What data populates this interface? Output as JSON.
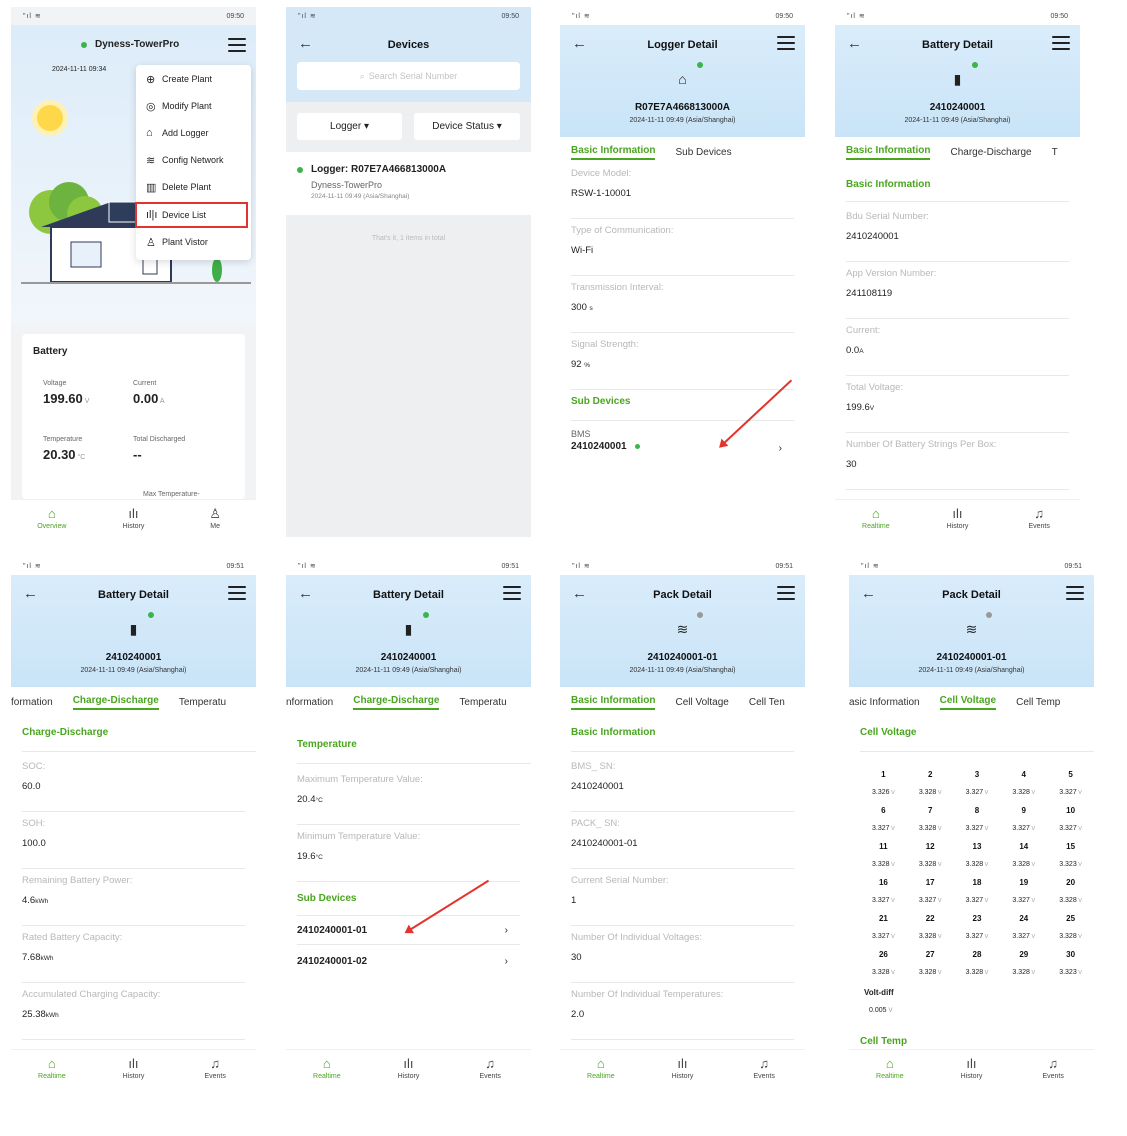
{
  "status": {
    "time1": "09:50",
    "time2": "09:51",
    "signal": "\"ıl ≋"
  },
  "p1": {
    "plant": "Dyness-TowerPro",
    "date": "2024-11-11 09:34",
    "menu": [
      "Create Plant",
      "Modify Plant",
      "Add Logger",
      "Config Network",
      "Delete Plant",
      "Device List",
      "Plant Vistor"
    ],
    "battery_title": "Battery",
    "voltage_label": "Voltage",
    "voltage": "199.60",
    "voltage_unit": "V",
    "current_label": "Current",
    "current": "0.00",
    "current_unit": "A",
    "temp_label": "Temperature",
    "temp": "20.30",
    "temp_unit": "°C",
    "discharged_label": "Total Discharged",
    "discharged": "--",
    "maxtemp_label": "Max Temperature-",
    "nav": [
      "Overview",
      "History",
      "Me"
    ]
  },
  "p2": {
    "title": "Devices",
    "search_placeholder": "Search Serial Number",
    "filter1": "Logger ▾",
    "filter2": "Device Status ▾",
    "logger": "Logger: R07E7A466813000A",
    "plant": "Dyness-TowerPro",
    "ts": "2024-11-11 09:49 (Asia/Shanghai)",
    "footer": "That's it, 1 items in total"
  },
  "p3": {
    "title": "Logger Detail",
    "sn": "R07E7A466813000A",
    "ts": "2024-11-11 09:49 (Asia/Shanghai)",
    "tabs": [
      "Basic Information",
      "Sub Devices"
    ],
    "fields": [
      {
        "label": "Device Model:",
        "value": "RSW-1-10001",
        "unit": ""
      },
      {
        "label": "Type of Communication:",
        "value": "Wi-Fi",
        "unit": ""
      },
      {
        "label": "Transmission Interval:",
        "value": "300",
        "unit": "s"
      },
      {
        "label": "Signal Strength:",
        "value": "92",
        "unit": "%"
      }
    ],
    "sub_title": "Sub Devices",
    "sub_type": "BMS",
    "sub_sn": "2410240001"
  },
  "p4": {
    "title": "Battery Detail",
    "sn": "2410240001",
    "ts": "2024-11-11 09:49 (Asia/Shanghai)",
    "tabs": [
      "Basic Information",
      "Charge-Discharge",
      "T"
    ],
    "sec": "Basic Information",
    "fields": [
      {
        "label": "Bdu Serial Number:",
        "value": "2410240001",
        "unit": ""
      },
      {
        "label": "App Version Number:",
        "value": "241108119",
        "unit": ""
      },
      {
        "label": "Current:",
        "value": "0.0",
        "unit": "A"
      },
      {
        "label": "Total Voltage:",
        "value": "199.6",
        "unit": "V"
      },
      {
        "label": "Number Of Battery Strings Per Box:",
        "value": "30",
        "unit": ""
      }
    ]
  },
  "nav2": [
    "Realtime",
    "History",
    "Events"
  ],
  "p5": {
    "title": "Battery Detail",
    "sn": "2410240001",
    "ts": "2024-11-11 09:49 (Asia/Shanghai)",
    "tabs": [
      "formation",
      "Charge-Discharge",
      "Temperatu"
    ],
    "sec": "Charge-Discharge",
    "fields": [
      {
        "label": "SOC:",
        "value": "60.0",
        "unit": ""
      },
      {
        "label": "SOH:",
        "value": "100.0",
        "unit": ""
      },
      {
        "label": "Remaining Battery Power:",
        "value": "4.6",
        "unit": "kWh"
      },
      {
        "label": "Rated Battery Capacity:",
        "value": "7.68",
        "unit": "kWh"
      },
      {
        "label": "Accumulated Charging Capacity:",
        "value": "25.38",
        "unit": "kWh"
      }
    ]
  },
  "p6": {
    "title": "Battery Detail",
    "sn": "2410240001",
    "ts": "2024-11-11 09:49 (Asia/Shanghai)",
    "tabs": [
      "nformation",
      "Charge-Discharge",
      "Temperatu"
    ],
    "sec": "Temperature",
    "fields": [
      {
        "label": "Maximum Temperature Value:",
        "value": "20.4",
        "unit": "°C"
      },
      {
        "label": "Minimum Temperature Value:",
        "value": "19.6",
        "unit": "°C"
      }
    ],
    "sub_title": "Sub Devices",
    "subs": [
      "2410240001-01",
      "2410240001-02"
    ]
  },
  "p7": {
    "title": "Pack Detail",
    "sn": "2410240001-01",
    "ts": "2024-11-11 09:49 (Asia/Shanghai)",
    "tabs": [
      "Basic Information",
      "Cell Voltage",
      "Cell Ten"
    ],
    "sec": "Basic Information",
    "fields": [
      {
        "label": "BMS_ SN:",
        "value": "2410240001",
        "unit": ""
      },
      {
        "label": "PACK_ SN:",
        "value": "2410240001-01",
        "unit": ""
      },
      {
        "label": "Current Serial Number:",
        "value": "1",
        "unit": ""
      },
      {
        "label": "Number Of Individual Voltages:",
        "value": "30",
        "unit": ""
      },
      {
        "label": "Number Of Individual Temperatures:",
        "value": "2.0",
        "unit": ""
      }
    ]
  },
  "p8": {
    "title": "Pack Detail",
    "sn": "2410240001-01",
    "ts": "2024-11-11 09:49 (Asia/Shanghai)",
    "tabs": [
      "asic Information",
      "Cell Voltage",
      "Cell Temp"
    ],
    "sec": "Cell Voltage",
    "cells": [
      "3.326",
      "3.328",
      "3.327",
      "3.328",
      "3.327",
      "3.327",
      "3.328",
      "3.327",
      "3.327",
      "3.327",
      "3.328",
      "3.328",
      "3.328",
      "3.328",
      "3.323",
      "3.327",
      "3.327",
      "3.327",
      "3.327",
      "3.328",
      "3.327",
      "3.328",
      "3.327",
      "3.327",
      "3.328",
      "3.328",
      "3.328",
      "3.328",
      "3.328",
      "3.323"
    ],
    "cell_unit": "V",
    "volt_diff_label": "Volt-diff",
    "volt_diff": "0.005",
    "sec2": "Cell Temp"
  }
}
